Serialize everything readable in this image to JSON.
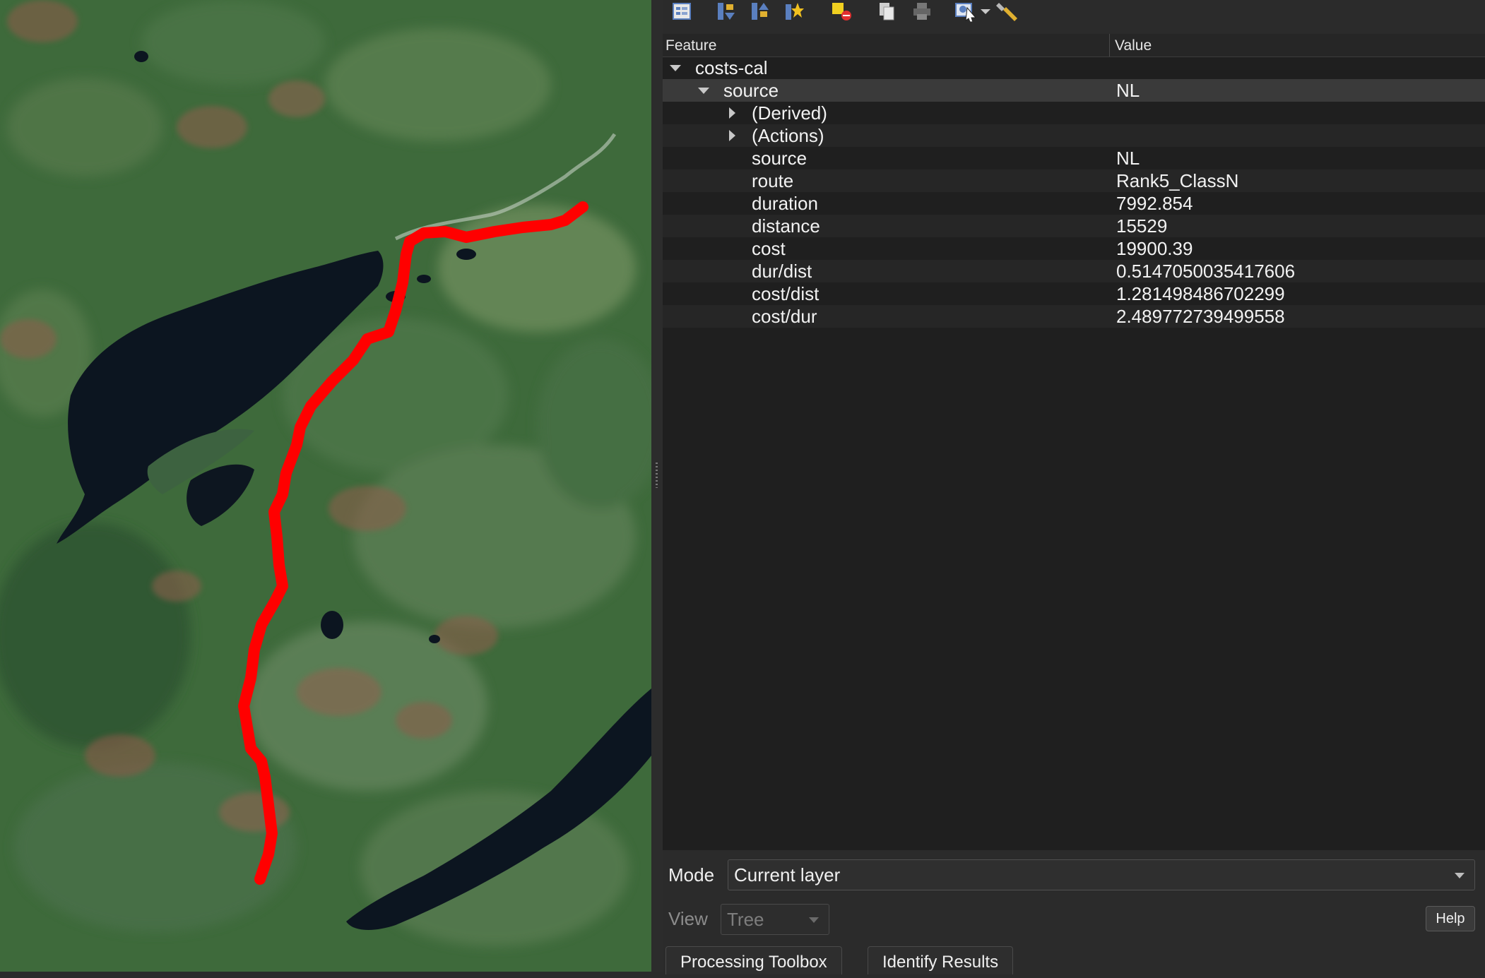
{
  "toolbar": {
    "icons": [
      "expand-tree-icon",
      "expand-all-icon",
      "collapse-all-icon",
      "expand-new-results-icon",
      "clear-results-icon",
      "copy-icon",
      "print-icon",
      "identify-settings-icon",
      "dropdown-icon",
      "settings-icon"
    ]
  },
  "tree": {
    "header": {
      "feature": "Feature",
      "value": "Value"
    },
    "layer": {
      "name": "costs-cal"
    },
    "feature": {
      "name": "source",
      "value": "NL"
    },
    "groups": [
      {
        "label": "(Derived)"
      },
      {
        "label": "(Actions)"
      }
    ],
    "attributes": [
      {
        "name": "source",
        "value": "NL"
      },
      {
        "name": "route",
        "value": "Rank5_ClassN"
      },
      {
        "name": "duration",
        "value": "7992.854"
      },
      {
        "name": "distance",
        "value": "15529"
      },
      {
        "name": "cost",
        "value": "19900.39"
      },
      {
        "name": "dur/dist",
        "value": "0.5147050035417606"
      },
      {
        "name": "cost/dist",
        "value": "1.281498486702299"
      },
      {
        "name": "cost/dur",
        "value": "2.489772739499558"
      }
    ]
  },
  "mode": {
    "label": "Mode",
    "value": "Current layer"
  },
  "view": {
    "label": "View",
    "value": "Tree"
  },
  "help_label": "Help",
  "tabs": [
    {
      "label": "Processing Toolbox"
    },
    {
      "label": "Identify Results"
    }
  ],
  "map": {
    "route_color": "#ff0000",
    "water_color": "#0c1520",
    "forest_color": "#3f6a3a"
  }
}
